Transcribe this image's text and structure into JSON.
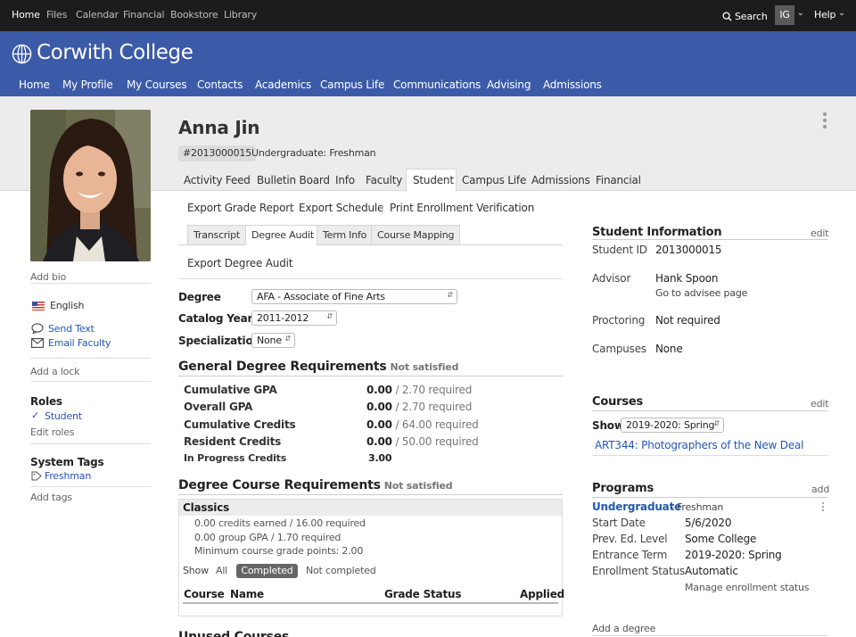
{
  "topnav": {
    "items": [
      "Home",
      "Files",
      "Calendar",
      "Financial",
      "Bookstore",
      "Library"
    ],
    "search_label": "Search",
    "user_initials": "IG",
    "help_label": "Help"
  },
  "brand": {
    "name": "Corwith College",
    "nav": [
      "Home",
      "My Profile",
      "My Courses",
      "Contacts",
      "Academics",
      "Campus Life",
      "Communications",
      "Advising",
      "Admissions"
    ]
  },
  "profile": {
    "name": "Anna Jin",
    "id_badge": "#2013000015",
    "level": "Undergraduate: Freshman",
    "tabs": [
      "Activity Feed",
      "Bulletin Board",
      "Info",
      "Faculty",
      "Student",
      "Campus Life",
      "Admissions",
      "Financial"
    ],
    "active_tab": "Student"
  },
  "sidebar": {
    "add_bio": "Add bio",
    "language": "English",
    "send_text": "Send Text",
    "email_faculty": "Email Faculty",
    "add_lock": "Add a lock",
    "roles_heading": "Roles",
    "role": "Student",
    "edit_roles": "Edit roles",
    "system_tags_heading": "System Tags",
    "tag": "Freshman",
    "add_tags": "Add tags"
  },
  "student_actions": [
    "Export Grade Report",
    "Export Schedule",
    "Print Enrollment Verification"
  ],
  "subtabs": [
    "Transcript",
    "Degree Audit",
    "Term Info",
    "Course Mapping"
  ],
  "export_degree_audit": "Export Degree Audit",
  "degree_form": {
    "degree_label": "Degree",
    "degree_value": "AFA - Associate of Fine Arts",
    "catalog_label": "Catalog Year",
    "catalog_value": "2011-2012",
    "specialization_label": "Specialization",
    "specialization_value": "None"
  },
  "general_requirements": {
    "title": "General Degree Requirements",
    "status": "Not satisfied",
    "rows": [
      {
        "label": "Cumulative GPA",
        "value": "0.00",
        "required": "/ 2.70 required"
      },
      {
        "label": "Overall GPA",
        "value": "0.00",
        "required": "/ 2.70 required"
      },
      {
        "label": "Cumulative Credits",
        "value": "0.00",
        "required": "/ 64.00 required"
      },
      {
        "label": "Resident Credits",
        "value": "0.00",
        "required": "/ 50.00 required"
      },
      {
        "label": "In Progress Credits",
        "value": "3.00",
        "required": ""
      }
    ]
  },
  "course_requirements": {
    "title": "Degree Course Requirements",
    "status": "Not satisfied",
    "group_name": "Classics",
    "details": [
      "0.00 credits earned / 16.00 required",
      "0.00 group GPA / 1.70 required",
      "Minimum course grade points: 2.00"
    ],
    "show_label": "Show",
    "filters": [
      "All",
      "Completed",
      "Not completed"
    ],
    "active_filter": "Completed",
    "columns": [
      "Course",
      "Name",
      "Grade Status",
      "Applied"
    ]
  },
  "unused_heading": "Unused Courses",
  "student_info": {
    "title": "Student Information",
    "edit": "edit",
    "rows": [
      {
        "label": "Student ID",
        "value": "2013000015"
      },
      {
        "label": "Advisor",
        "value": "Hank Spoon",
        "sub": "Go to advisee page"
      },
      {
        "label": "Proctoring",
        "value": "Not required"
      },
      {
        "label": "Campuses",
        "value": "None"
      }
    ]
  },
  "courses": {
    "title": "Courses",
    "edit": "edit",
    "show_label": "Show",
    "term": "2019-2020: Spring",
    "course_link": "ART344: Photographers of the New Deal"
  },
  "programs": {
    "title": "Programs",
    "add": "add",
    "program_name": "Undergraduate",
    "program_level": "- Freshman",
    "rows": [
      {
        "label": "Start Date",
        "value": "5/6/2020"
      },
      {
        "label": "Prev. Ed. Level",
        "value": "Some College"
      },
      {
        "label": "Entrance Term",
        "value": "2019-2020: Spring"
      },
      {
        "label": "Enrollment Status",
        "value": "Automatic"
      }
    ],
    "manage_status": "Manage enrollment status",
    "add_degree": "Add a degree"
  },
  "colors": {
    "brand": "#3b5ba8",
    "topbar": "#1c1c1c",
    "link": "#2456b6",
    "band": "#ececec"
  }
}
